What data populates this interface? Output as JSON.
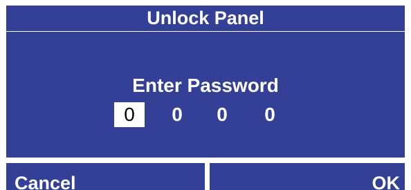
{
  "panel": {
    "title": "Unlock Panel",
    "prompt": "Enter Password",
    "digits": [
      "0",
      "0",
      "0",
      "0"
    ],
    "active_digit": 0
  },
  "buttons": {
    "cancel_label": "Cancel",
    "ok_label": "OK"
  },
  "colors": {
    "panel_blue": "#343f96",
    "text": "#ffffff",
    "active_digit_bg": "#ffffff",
    "active_digit_text": "#000000"
  }
}
